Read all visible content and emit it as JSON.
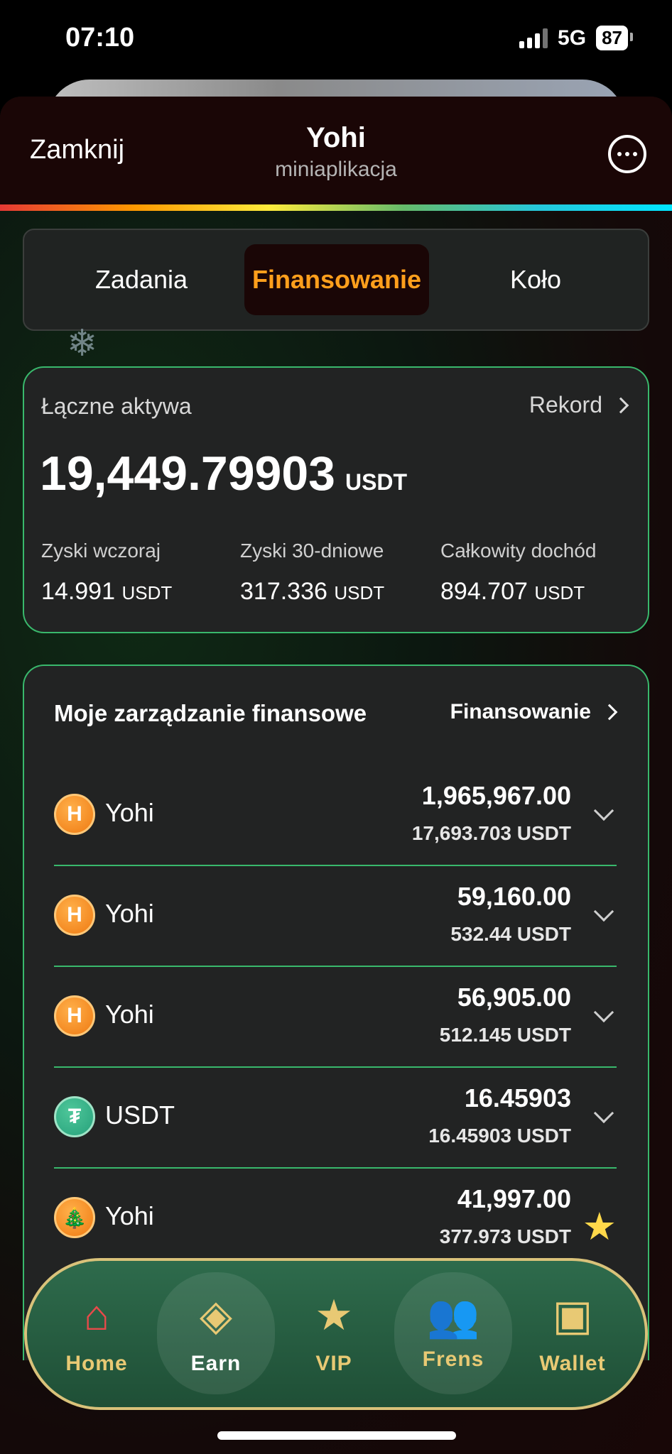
{
  "status_bar": {
    "time": "07:10",
    "network": "5G",
    "battery": "87"
  },
  "header": {
    "close_label": "Zamknij",
    "title": "Yohi",
    "subtitle": "miniaplikacja"
  },
  "tabs": [
    {
      "label": "Zadania",
      "active": false
    },
    {
      "label": "Finansowanie",
      "active": true
    },
    {
      "label": "Koło",
      "active": false
    }
  ],
  "assets": {
    "label": "Łączne aktywa",
    "record_label": "Rekord",
    "total_value": "19,449.79903",
    "total_unit": "USDT",
    "stats": [
      {
        "label": "Zyski wczoraj",
        "value": "14.991",
        "unit": "USDT"
      },
      {
        "label": "Zyski 30-dniowe",
        "value": "317.336",
        "unit": "USDT"
      },
      {
        "label": "Całkowity dochód",
        "value": "894.707",
        "unit": "USDT"
      }
    ]
  },
  "finance": {
    "title": "Moje zarządzanie finansowe",
    "link_label": "Finansowanie",
    "rows": [
      {
        "name": "Yohi",
        "amount": "1,965,967.00",
        "usdt_value": "17,693.703",
        "unit": "USDT",
        "icon": "yohi-coin-icon"
      },
      {
        "name": "Yohi",
        "amount": "59,160.00",
        "usdt_value": "532.44",
        "unit": "USDT",
        "icon": "yohi-coin-icon"
      },
      {
        "name": "Yohi",
        "amount": "56,905.00",
        "usdt_value": "512.145",
        "unit": "USDT",
        "icon": "yohi-coin-icon"
      },
      {
        "name": "USDT",
        "amount": "16.45903",
        "usdt_value": "16.45903",
        "unit": "USDT",
        "icon": "tether-coin-icon"
      },
      {
        "name": "Yohi",
        "amount": "41,997.00",
        "usdt_value": "377.973",
        "unit": "USDT",
        "icon": "christmas-tree-coin-icon"
      }
    ]
  },
  "bottom_nav": [
    {
      "label": "Home",
      "icon": "home-icon",
      "active": false
    },
    {
      "label": "Earn",
      "icon": "earn-icon",
      "active": true
    },
    {
      "label": "VIP",
      "icon": "vip-star-icon",
      "active": false
    },
    {
      "label": "Frens",
      "icon": "frens-icon",
      "active": false
    },
    {
      "label": "Wallet",
      "icon": "wallet-icon",
      "active": false
    }
  ],
  "colors": {
    "accent_green": "#39b86c",
    "active_tab": "#ff9f1c",
    "nav_label": "#e8c974"
  }
}
